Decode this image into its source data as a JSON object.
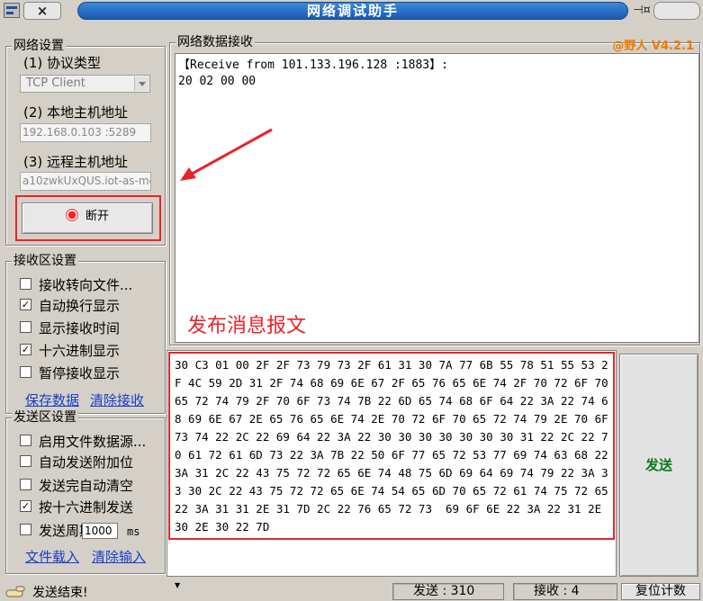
{
  "window": {
    "close_glyph": "×",
    "title": "网络调试助手",
    "pin_glyph": "⊣¤"
  },
  "net_settings": {
    "group_label": "网络设置",
    "protocol_label": "(1) 协议类型",
    "protocol_value": "TCP Client",
    "local_label": "(2) 本地主机地址",
    "local_value": "192.168.0.103 :5289",
    "remote_label": "(3) 远程主机地址",
    "remote_value": "a10zwkUxQUS.iot-as-mq",
    "disconnect_label": "断开",
    "accent": "#e8242a"
  },
  "recv_settings": {
    "group_label": "接收区设置",
    "options": [
      {
        "label": "接收转向文件...",
        "checked": false
      },
      {
        "label": "自动换行显示",
        "checked": true
      },
      {
        "label": "显示接收时间",
        "checked": false
      },
      {
        "label": "十六进制显示",
        "checked": true
      },
      {
        "label": "暂停接收显示",
        "checked": false
      }
    ],
    "save_link": "保存数据",
    "clear_link": "清除接收"
  },
  "send_settings": {
    "group_label": "发送区设置",
    "options": [
      {
        "label": "启用文件数据源...",
        "checked": false
      },
      {
        "label": "自动发送附加位",
        "checked": false
      },
      {
        "label": "发送完自动清空",
        "checked": false
      },
      {
        "label": "按十六进制发送",
        "checked": true
      }
    ],
    "period_label": "发送周期",
    "period_value": "1000",
    "period_unit": "ms",
    "load_link": "文件载入",
    "clear_link": "清除输入"
  },
  "receive": {
    "group_label": "网络数据接收",
    "version": "@野人 V4.2.1",
    "header": "【Receive from 101.133.196.128 :1883】:",
    "data": "20 02 00 00"
  },
  "annotation": "发布消息报文",
  "send": {
    "data": "30 C3 01 00 2F 2F 73 79 73 2F 61 31 30 7A 77 6B 55 78 51 55 53 2F 4C 59 2D 31 2F 74 68 69 6E 67 2F 65 76 65 6E 74 2F 70 72 6F 70 65 72 74 79 2F 70 6F 73 74 7B 22 6D 65 74 68 6F 64 22 3A 22 74 68 69 6E 67 2E 65 76 65 6E 74 2E 70 72 6F 70 65 72 74 79 2E 70 6F 73 74 22 2C 22 69 64 22 3A 22 30 30 30 30 30 30 30 31 22 2C 22 70 61 72 61 6D 73 22 3A 7B 22 50 6F 77 65 72 53 77 69 74 63 68 22 3A 31 2C 22 43 75 72 72 65 6E 74 48 75 6D 69 64 69 74 79 22 3A 33 30 2C 22 43 75 72 72 65 6E 74 54 65 6D 70 65 72 61 74 75 72 65 22 3A 31 31 2E 31 7D 2C 22 76 65 72 73  69 6F 6E 22 3A 22 31 2E 30 2E 30 22 7D",
    "button_label": "发送"
  },
  "status": {
    "message": "发送结束!",
    "sent": "发送 : 310",
    "received": "接收 : 4",
    "reset_label": "复位计数"
  }
}
